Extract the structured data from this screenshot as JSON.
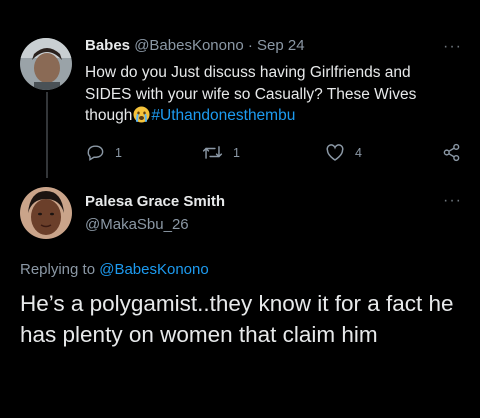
{
  "tweet1": {
    "display_name": "Babes",
    "handle": "@BabesKonono",
    "separator": "·",
    "date": "Sep 24",
    "text": "How do you Just discuss having Girlfriends and SIDES with your wife so Casually? These Wives though",
    "emoji": "crying-face-emoji",
    "hashtag": "#Uthandonesthembu",
    "reply_count": "1",
    "retweet_count": "1",
    "like_count": "4",
    "more": "···"
  },
  "tweet2": {
    "display_name": "Palesa Grace Smith",
    "handle": "@MakaSbu_26",
    "more": "···",
    "replying_prefix": "Replying to",
    "replying_to": "@BabesKonono",
    "text": "He’s a polygamist..they know it for a fact he has plenty on women that claim him"
  },
  "colors": {
    "background": "#000000",
    "text": "#e7e9ea",
    "muted": "#8b98a5",
    "link": "#1d9bf0"
  }
}
